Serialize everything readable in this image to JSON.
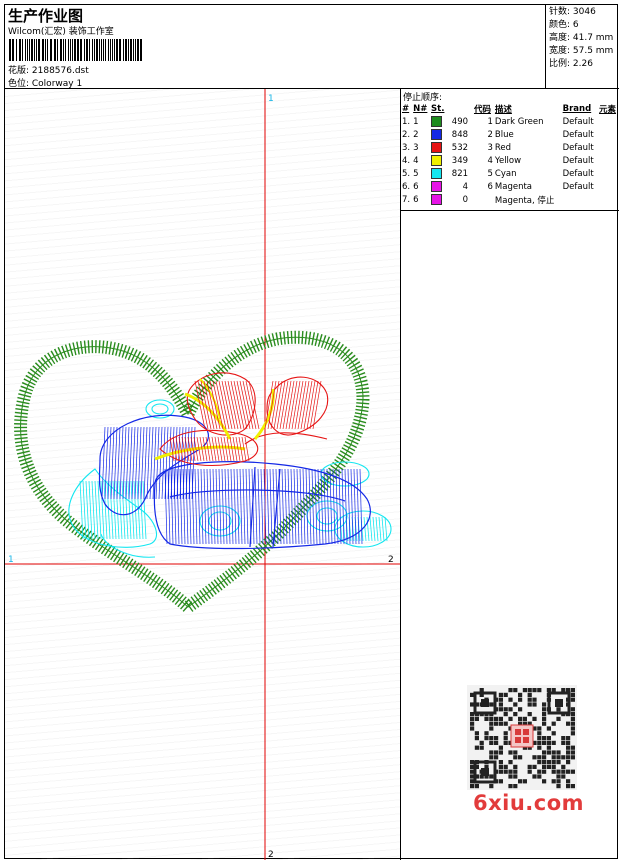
{
  "header": {
    "title": "生产作业图",
    "company": "Wilcom(汇宏) 装饰工作室",
    "pattern_label": "花版: 2188576.dst",
    "color_label": "色位: Colorway 1"
  },
  "stats": {
    "stitches": "针数: 3046",
    "colors": "颜色: 6",
    "height": "高度: 41.7 mm",
    "width": "宽度: 57.5 mm",
    "scale": "比例: 2.26"
  },
  "canvas": {
    "axis_top": "1",
    "axis_bottom": "2",
    "axis_left": "1",
    "axis_right": "2"
  },
  "sequence": {
    "heading": "停止顺序:",
    "columns": [
      "#",
      "N#",
      "St.",
      "代码",
      "描述",
      "Brand",
      "元素"
    ],
    "rows": [
      {
        "idx": "1.",
        "n": "1",
        "st": "490",
        "code": "1",
        "desc": "Dark Green",
        "brand": "Default",
        "color": "#1e8c1e"
      },
      {
        "idx": "2.",
        "n": "2",
        "st": "848",
        "code": "2",
        "desc": "Blue",
        "brand": "Default",
        "color": "#1428e6"
      },
      {
        "idx": "3.",
        "n": "3",
        "st": "532",
        "code": "3",
        "desc": "Red",
        "brand": "Default",
        "color": "#e61414"
      },
      {
        "idx": "4.",
        "n": "4",
        "st": "349",
        "code": "4",
        "desc": "Yellow",
        "brand": "Default",
        "color": "#f0f000"
      },
      {
        "idx": "5.",
        "n": "5",
        "st": "821",
        "code": "5",
        "desc": "Cyan",
        "brand": "Default",
        "color": "#14e6f0"
      },
      {
        "idx": "6.",
        "n": "6",
        "st": "4",
        "code": "6",
        "desc": "Magenta",
        "brand": "Default",
        "color": "#e614e6"
      },
      {
        "idx": "7.",
        "n": "6",
        "st": "0",
        "code": "",
        "desc": "Magenta, 停止",
        "brand": "",
        "color": "#e614e6"
      }
    ]
  },
  "watermark": "6xiu.com",
  "colors": {
    "crosshair": "#e00000",
    "green": "#2a8c1e",
    "blue": "#1428e6",
    "red": "#e61414",
    "yellow": "#f0f000",
    "cyan": "#14e6f0"
  }
}
